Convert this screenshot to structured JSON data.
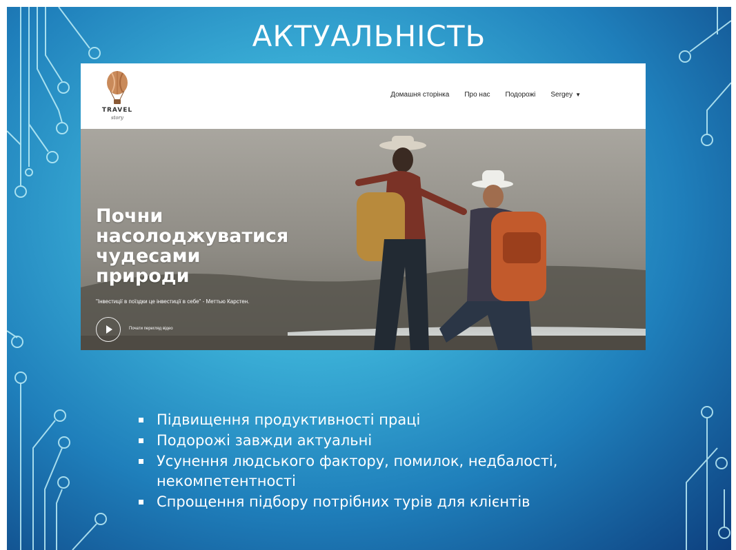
{
  "slide": {
    "title": "АКТУАЛЬНІСТЬ",
    "colors": {
      "bg_center": "#5fd0e6",
      "bg_edge": "#0d3f7e",
      "circuit": "#bfeff8"
    }
  },
  "website": {
    "logo": {
      "icon": "hot-air-balloon-icon",
      "word": "TRAVEL",
      "sub": "story",
      "color": "#c98a5a"
    },
    "nav": {
      "home": "Домашня сторінка",
      "about": "Про нас",
      "trips": "Подорожі",
      "user": "Sergey"
    },
    "hero": {
      "title_lines": [
        "Почни",
        "насолоджуватися",
        "чудесами",
        "природи"
      ],
      "quote": "\"Інвестиції в поїздки це інвестиції в себе\" - Меттью Карстен.",
      "play_label": "Почати перегляд відео"
    }
  },
  "bullets": [
    "Підвищення продуктивності праці",
    "Подорожі завжди актуальні",
    "Усунення людського фактору, помилок, недбалості, некомпетентності",
    "Спрощення підбору потрібних турів для клієнтів"
  ]
}
